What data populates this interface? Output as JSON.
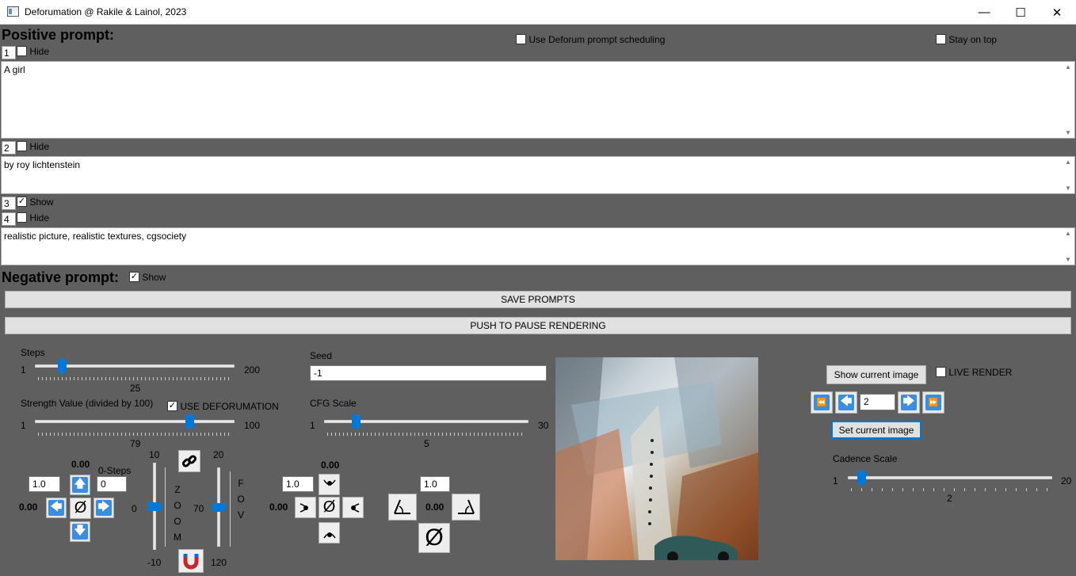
{
  "window": {
    "title": "Deforumation @ Rakile & Lainol, 2023",
    "minimize": "—",
    "maximize": "☐",
    "close": "✕"
  },
  "prompts": {
    "positive_heading": "Positive prompt:",
    "use_scheduling": "Use Deforum prompt scheduling",
    "stay_on_top": "Stay on top",
    "rows": [
      {
        "num": "1",
        "toggle": "Hide",
        "checked": false,
        "text": "A girl"
      },
      {
        "num": "2",
        "toggle": "Hide",
        "checked": false,
        "text": "by roy lichtenstein"
      },
      {
        "num": "3",
        "toggle": "Show",
        "checked": true,
        "text": ""
      },
      {
        "num": "4",
        "toggle": "Hide",
        "checked": false,
        "text": "realistic picture, realistic textures, cgsociety"
      }
    ],
    "negative_heading": "Negative prompt:",
    "negative_toggle": "Show",
    "check": "✓"
  },
  "buttons": {
    "save": "SAVE PROMPTS",
    "pause": "PUSH TO PAUSE RENDERING"
  },
  "steps": {
    "label": "Steps",
    "min": "1",
    "max": "200",
    "value": "25",
    "fraction": 0.12
  },
  "strength": {
    "label": "Strength Value (divided by 100)",
    "use_deforumation": "USE DEFORUMATION",
    "min": "1",
    "max": "100",
    "value": "79",
    "fraction": 0.79
  },
  "seed": {
    "label": "Seed",
    "value": "-1"
  },
  "cfg": {
    "label": "CFG Scale",
    "min": "1",
    "max": "30",
    "value": "5",
    "fraction": 0.14
  },
  "pan": {
    "top_value": "0.00",
    "left_value": "0.00",
    "step": "1.0",
    "zero_steps_label": "0-Steps",
    "zero_steps_value": "0",
    "center": "Ø",
    "up": "🡅",
    "left": "🡄",
    "right": "🡆",
    "down": "🡇"
  },
  "zoom": {
    "top": "10",
    "mid": "0",
    "bottom": "-10",
    "letters": [
      "Z",
      "O",
      "O",
      "M"
    ],
    "fraction": 0.5
  },
  "fov": {
    "top": "20",
    "mid": "70",
    "bottom": "120",
    "letters": [
      "F",
      "O",
      "V"
    ],
    "fraction": 0.5
  },
  "rotate": {
    "top_value": "0.00",
    "left_value": "0.00",
    "step": "1.0",
    "center": "Ø"
  },
  "tilt": {
    "step": "1.0",
    "value": "0.00",
    "center": "Ø"
  },
  "image_panel": {
    "show_current": "Show current image",
    "live_render": "LIVE RENDER",
    "frame": "2",
    "set_current": "Set current image",
    "first": "⏪",
    "prev": "🡄",
    "next": "🡆",
    "last": "⏩"
  },
  "cadence": {
    "label": "Cadence Scale",
    "min": "1",
    "max": "20",
    "value": "2",
    "fraction": 0.05
  },
  "icons": {
    "link": "link-icon",
    "magnet": "magnet-icon"
  }
}
